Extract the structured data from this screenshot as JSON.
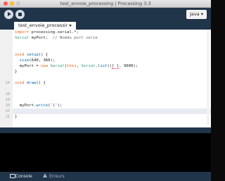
{
  "window": {
    "title": "test_envoie_processing | Processing 3.3",
    "controls": [
      "close",
      "minimize",
      "maximize"
    ]
  },
  "toolbar": {
    "run_icon": "play-icon",
    "stop_icon": "stop-icon",
    "mode_label": "Java ▾"
  },
  "tabs": [
    {
      "label": "test_envoie_processing",
      "active": true
    }
  ],
  "editor": {
    "current_line": 25,
    "lines": [
      {
        "n": "",
        "html": "<span class=\"kw\">import</span> processing.serial.*;"
      },
      {
        "n": "",
        "html": "<span class=\"tp\">Serial</span> myPort;  <span class=\"cm\">// Nomdu port serie</span>"
      },
      {
        "n": "",
        "html": ""
      },
      {
        "n": "",
        "html": ""
      },
      {
        "n": "",
        "html": "<span class=\"kw\">void</span> <span class=\"fn\">setup</span>() {"
      },
      {
        "n": "",
        "html": "  <span class=\"fn\">size</span>(640, 360);"
      },
      {
        "n": "",
        "html": "  myPort = <span class=\"kw\">new</span> <span class=\"tp\">Serial</span>(<span class=\"kw\">this</span>, <span class=\"tp\">Serial</span>.<span class=\"fn\">list</span>()<span class=\"err\">[ ]</span>, 9600);"
      },
      {
        "n": "",
        "html": "}"
      },
      {
        "n": "",
        "html": ""
      },
      {
        "n": "",
        "html": "<span class=\"kw\">void</span> <span class=\"fn\">draw</span>() {"
      },
      {
        "n": "",
        "html": ""
      },
      {
        "n": "",
        "html": ""
      },
      {
        "n": "",
        "html": ""
      },
      {
        "n": "",
        "html": "  myPort.<span class=\"fn\">write</span>(<span class=\"st\">'1'</span>);"
      },
      {
        "n": "25",
        "html": ""
      },
      {
        "n": "",
        "html": "}"
      }
    ],
    "line_numbers_visible": [
      "14",
      "18",
      "19",
      "20",
      "21",
      "25"
    ]
  },
  "footer": {
    "console_label": "Console",
    "errors_label": "Erreurs"
  },
  "colors": {
    "toolbar_bg": "#21354a",
    "keyword": "#e2661a",
    "type": "#33997e",
    "function": "#006699",
    "string": "#7d4793",
    "comment": "#666666"
  }
}
